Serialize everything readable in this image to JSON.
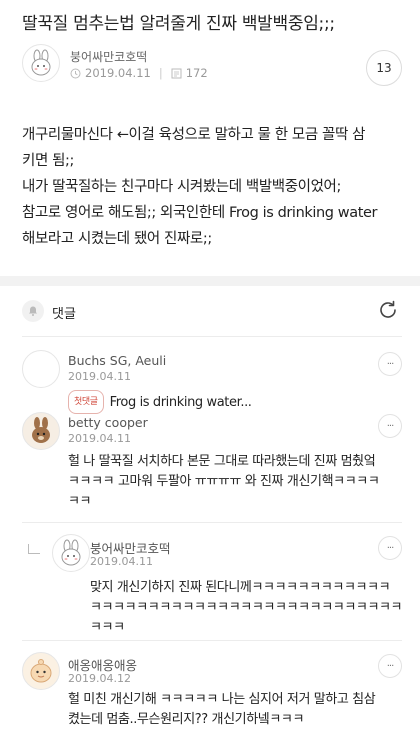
{
  "post": {
    "title": "딸꾹질 멈추는법 알려줄게 진짜 백발백중임;;;",
    "author": "붕어싸만코호떡",
    "date": "2019.04.11",
    "views": "172",
    "comment_count": "13",
    "body_lines": [
      "개구리물마신다 ←이걸 육성으로 말하고 물 한 모금 꼴딱 삼",
      "키면 됨;;",
      "내가 딸꾹질하는 친구마다 시켜봤는데 백발백중이었어;",
      "참고로 영어로 해도됨;; 외국인한테 Frog is drinking water",
      "해보라고 시켰는데 됐어 진짜로;;"
    ]
  },
  "comments_header": {
    "label": "댓글"
  },
  "comments": [
    {
      "name": "Buchs SG, Aeuli",
      "date": "2019.04.11",
      "tag": "첫댓글",
      "lines": [
        "Frog is drinking water..."
      ]
    },
    {
      "name": "betty cooper",
      "date": "2019.04.11",
      "lines": [
        "헐 나 딸꾹질 서치하다 본문 그대로 따라했는데 진짜 멈췄엌",
        "ㅋㅋㅋㅋ 고마워 두팔아 ㅠㅠㅠㅠ 와 진짜 개신기핵ㅋㅋㅋㅋ",
        "ㅋㅋ"
      ]
    },
    {
      "name": "붕어싸만코호떡",
      "date": "2019.04.11",
      "lines": [
        "맞지 개신기하지 진짜 된다니께ㅋㅋㅋㅋㅋㅋㅋㅋㅋㅋㅋㅋ",
        "ㅋㅋㅋㅋㅋㅋㅋㅋㅋㅋㅋㅋㅋㅋㅋㅋㅋㅋㅋㅋㅋㅋㅋㅋㅋㅋㅋ",
        "ㅋㅋㅋ"
      ]
    },
    {
      "name": "애옹애옹애옹",
      "date": "2019.04.12",
      "lines": [
        "헐 미친 개신기해 ㅋㅋㅋㅋㅋ 나는 심지어 저거 말하고 침삼",
        "켰는데 멈춤..무슨원리지?? 개신기하넼ㅋㅋㅋ"
      ]
    }
  ],
  "more_label": "···"
}
